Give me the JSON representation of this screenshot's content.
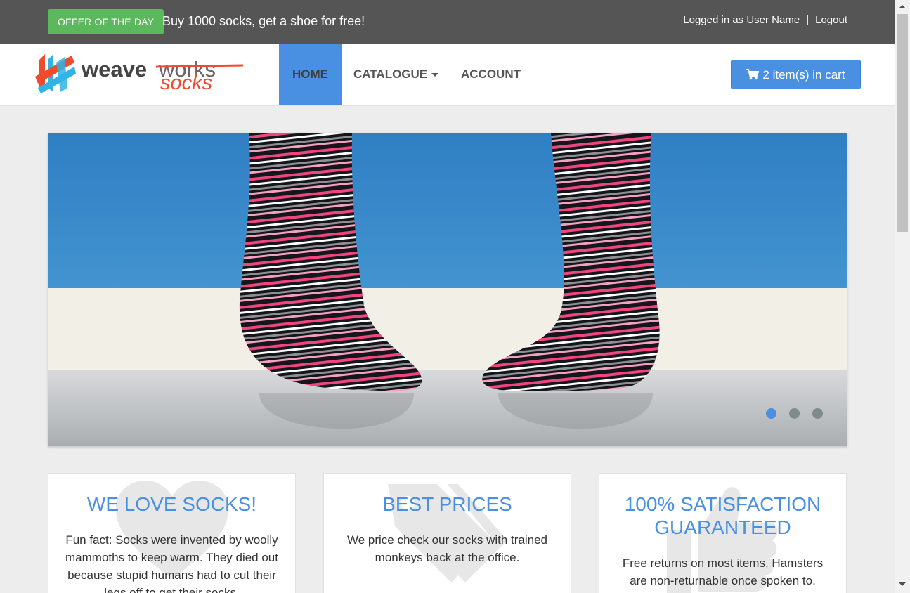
{
  "topbar": {
    "offer_badge": "OFFER OF THE DAY",
    "offer_text": "Buy 1000 socks, get a shoe for free!",
    "logged_in_text": "Logged in as User Name",
    "separator": "|",
    "logout_label": "Logout"
  },
  "logo": {
    "word1": "weave",
    "word2": "works",
    "word3": "socks"
  },
  "nav": {
    "items": [
      {
        "label": "HOME",
        "active": true
      },
      {
        "label": "CATALOGUE",
        "active": false,
        "dropdown": true
      },
      {
        "label": "ACCOUNT",
        "active": false
      }
    ],
    "cart_label": "2 item(s) in cart"
  },
  "carousel": {
    "slide_count": 3,
    "active_index": 0,
    "active_color": "#4a90e2",
    "inactive_color": "#7f8c8d"
  },
  "features": [
    {
      "icon": "heart-icon",
      "title": "WE LOVE SOCKS!",
      "text": "Fun fact: Socks were invented by woolly mammoths to keep warm. They died out because stupid humans had to cut their legs off to get their socks."
    },
    {
      "icon": "tags-icon",
      "title": "BEST PRICES",
      "text": "We price check our socks with trained monkeys back at the office."
    },
    {
      "icon": "thumbs-up-icon",
      "title": "100% SATISFACTION GUARANTEED",
      "text": "Free returns on most items. Hamsters are non-returnable once spoken to."
    }
  ],
  "colors": {
    "accent": "#4a90e2",
    "offer_green": "#5cb85c",
    "topbar": "#555555"
  }
}
